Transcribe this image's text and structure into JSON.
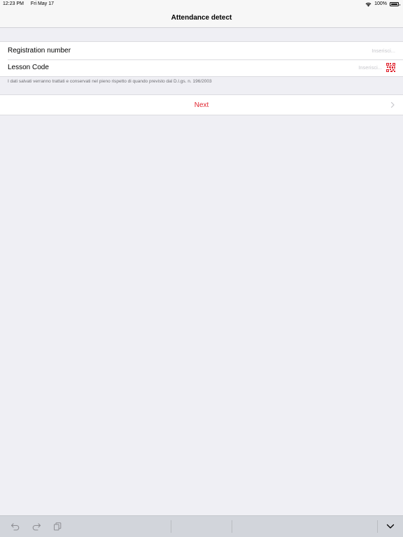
{
  "status_bar": {
    "time": "12:23 PM",
    "date": "Fri May 17",
    "battery_text": "100%",
    "wifi_icon": "wifi-icon",
    "battery_icon": "battery-icon",
    "battery_level": 1.0
  },
  "nav": {
    "title": "Attendance detect"
  },
  "form": {
    "registration": {
      "label": "Registration number",
      "value": "",
      "placeholder": "Inserisci..."
    },
    "lesson": {
      "label": "Lesson Code",
      "value": "",
      "placeholder": "Inserisci...",
      "scan_icon": "qr-code-icon"
    },
    "footer_note": "I dati salvati verranno trattati e conservati nel pieno rispetto di quando previsto dal D.l.gs. n. 196/2003"
  },
  "actions": {
    "next_label": "Next",
    "next_icon": "chevron-right-icon"
  },
  "keyboard_toolbar": {
    "undo_icon": "undo-icon",
    "redo_icon": "redo-icon",
    "paste_icon": "paste-icon",
    "hide_icon": "chevron-down-icon"
  },
  "colors": {
    "accent": "#e0242f",
    "background": "#efeff4",
    "placeholder": "#c7c7cc"
  }
}
